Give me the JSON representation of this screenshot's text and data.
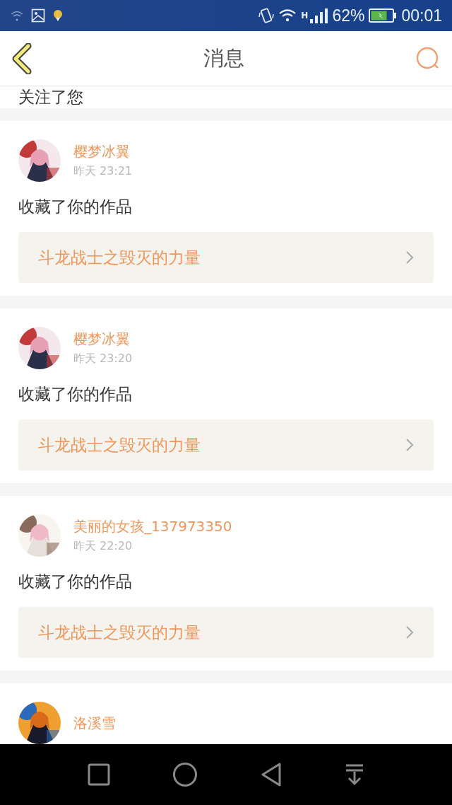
{
  "status_bar": {
    "network_type": "H",
    "battery": "62%",
    "time": "00:01"
  },
  "header": {
    "title": "消息"
  },
  "section": {
    "title": "关注了您"
  },
  "messages": [
    {
      "user": "樱梦冰翼",
      "time": "昨天 23:21",
      "action": "收藏了你的作品",
      "work": "斗龙战士之毁灭的力量"
    },
    {
      "user": "樱梦冰翼",
      "time": "昨天 23:20",
      "action": "收藏了你的作品",
      "work": "斗龙战士之毁灭的力量"
    },
    {
      "user": "美丽的女孩_137973350",
      "time": "昨天 22:20",
      "action": "收藏了你的作品",
      "work": "斗龙战士之毁灭的力量"
    },
    {
      "user": "洛溪雪"
    }
  ]
}
